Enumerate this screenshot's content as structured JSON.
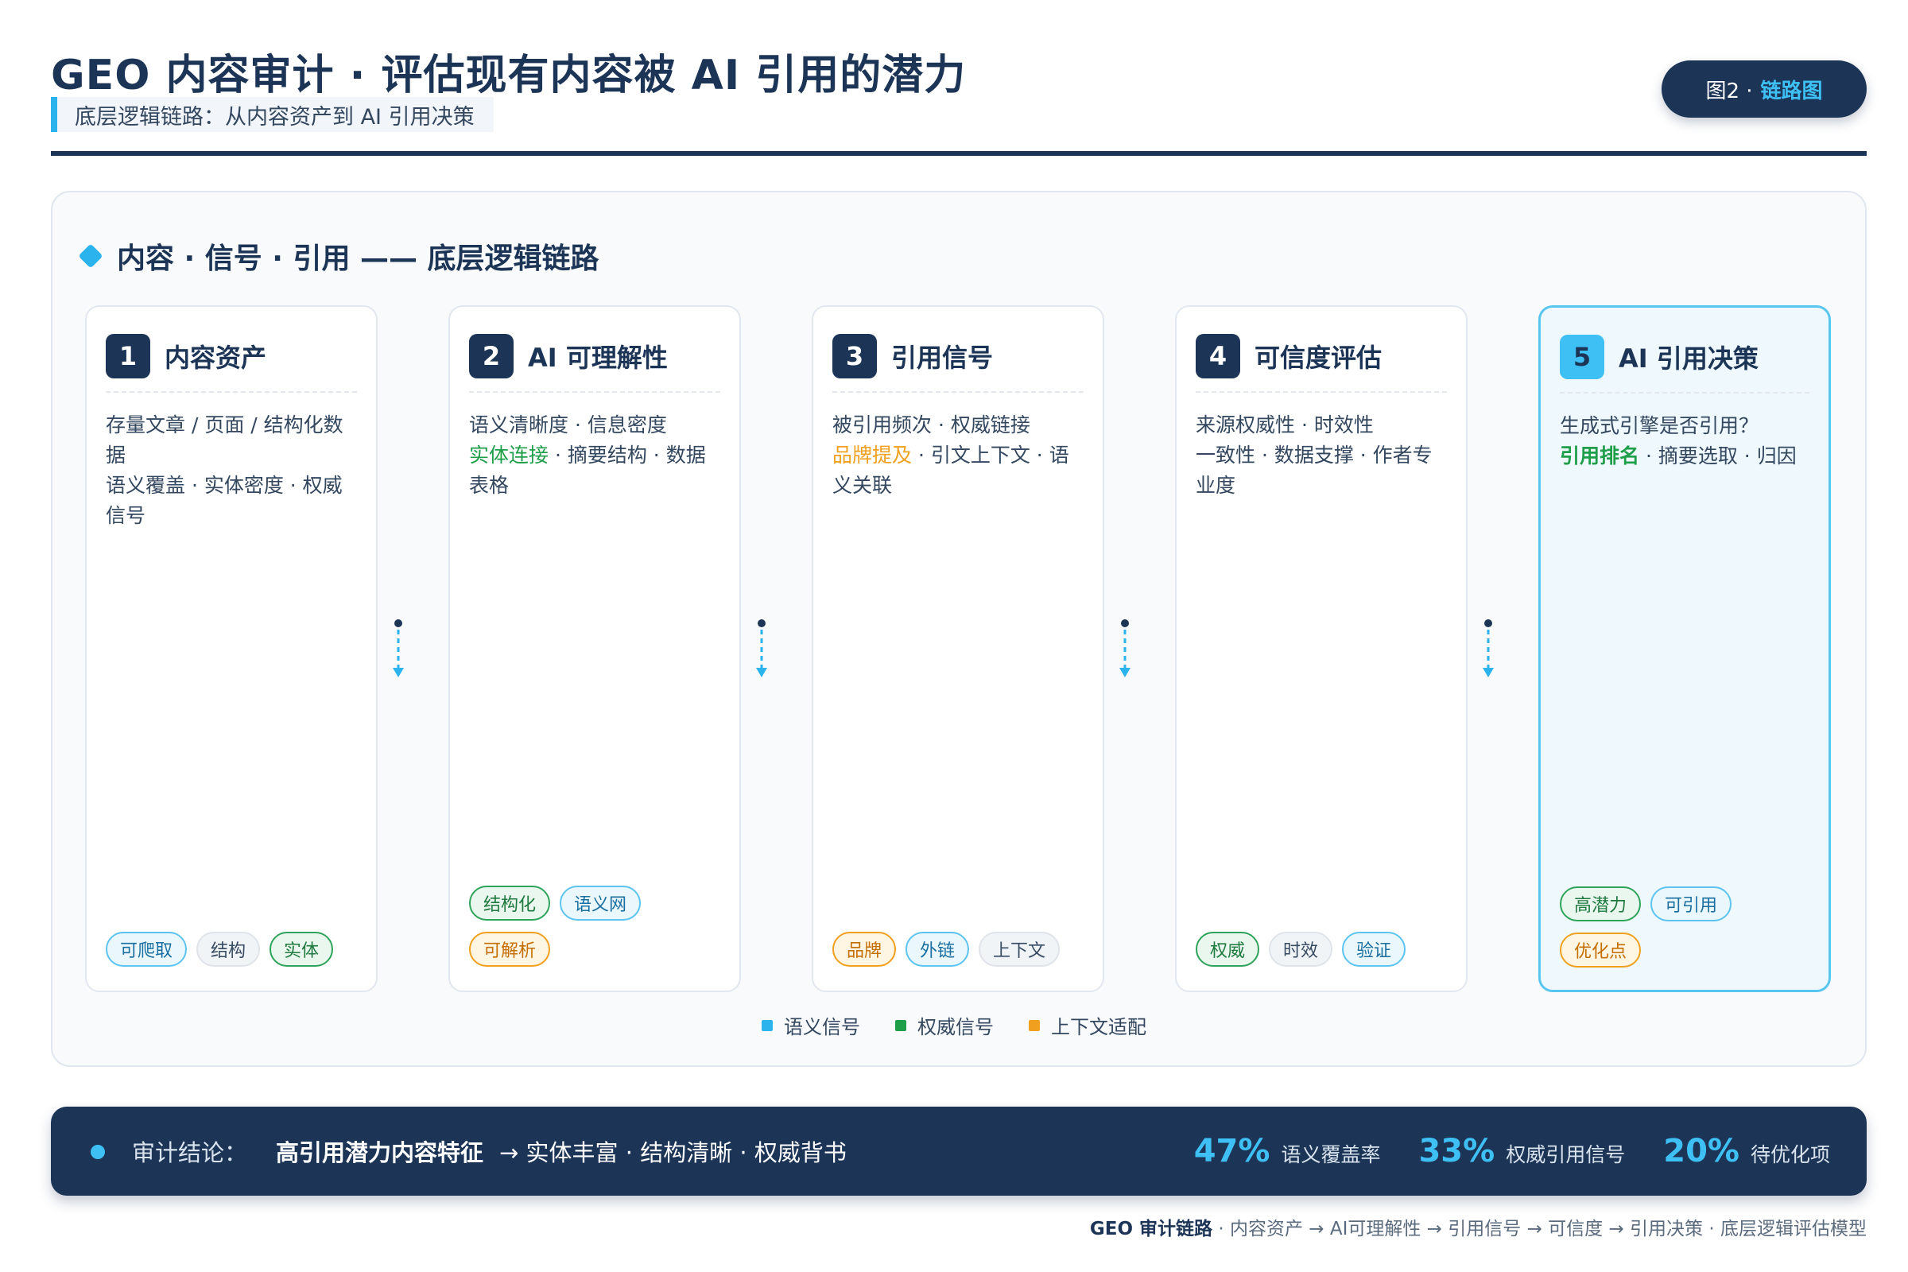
{
  "header": {
    "title": "GEO 内容审计 · 评估现有内容被 AI 引用的潜力",
    "subtitle": "底层逻辑链路：从内容资产到 AI 引用决策",
    "badge_prefix": "图2 ·",
    "badge_highlight": "链路图"
  },
  "section": {
    "title": "内容 · 信号 · 引用 —— 底层逻辑链路"
  },
  "cards": [
    {
      "number": "1",
      "title": "内容资产",
      "line1": "存量文章 / 页面 / 结构化数据",
      "line2": "语义覆盖 · 实体密度 · 权威信号",
      "tags": [
        "可爬取",
        "结构",
        "实体"
      ]
    },
    {
      "number": "2",
      "title": "AI 可理解性",
      "line1": "语义清晰度 · 信息密度",
      "line2_em": "实体连接",
      "line2_rest": " · 摘要结构 · 数据表格",
      "tags": [
        "结构化",
        "语义网",
        "可解析"
      ]
    },
    {
      "number": "3",
      "title": "引用信号",
      "line1": "被引用频次 · 权威链接",
      "line2_em": "品牌提及",
      "line2_rest": " · 引文上下文 · 语义关联",
      "tags": [
        "品牌",
        "外链",
        "上下文"
      ]
    },
    {
      "number": "4",
      "title": "可信度评估",
      "line1": "来源权威性 · 时效性",
      "line2": "一致性 · 数据支撑 · 作者专业度",
      "tags": [
        "权威",
        "时效",
        "验证"
      ]
    },
    {
      "number": "5",
      "title": "AI 引用决策",
      "line1": "生成式引擎是否引用？",
      "line2_em": "引用排名",
      "line2_rest": " · 摘要选取 · 归因",
      "tags": [
        "高潜力",
        "可引用",
        "优化点"
      ]
    }
  ],
  "legend": [
    {
      "label": "语义信号",
      "color": "#2bb3ee"
    },
    {
      "label": "权威信号",
      "color": "#1f9e4a"
    },
    {
      "label": "上下文适配",
      "color": "#f0a01e"
    }
  ],
  "conclusion": {
    "label": "审计结论：",
    "strong": "高引用潜力内容特征",
    "rest": "→ 实体丰富 · 结构清晰 · 权威背书",
    "stats": [
      {
        "value": "47%",
        "label": "语义覆盖率"
      },
      {
        "value": "33%",
        "label": "权威引用信号"
      },
      {
        "value": "20%",
        "label": "待优化项"
      }
    ]
  },
  "footer": {
    "brand": "GEO 审计链路",
    "text": " · 内容资产 → AI可理解性 → 引用信号 → 可信度 → 引用决策 · 底层逻辑评估模型"
  },
  "colors": {
    "navy": "#1c3557",
    "accent_blue": "#3ec0f5",
    "green": "#1f9e4a",
    "orange": "#f0a01e"
  }
}
